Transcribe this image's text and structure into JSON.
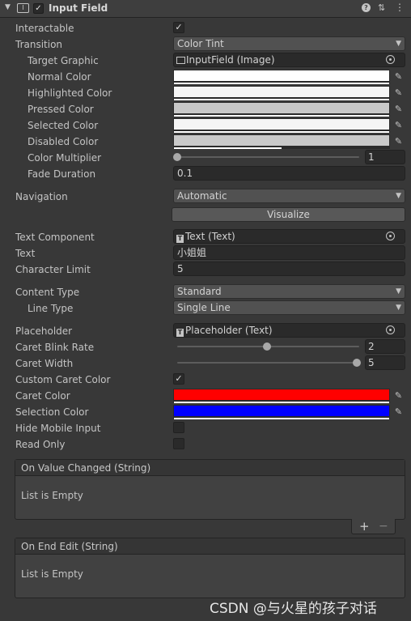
{
  "header": {
    "title": "Input Field",
    "enabled": true
  },
  "icons": {
    "help": "help-icon",
    "settings": "settings-icon",
    "more": "more-vertical-icon"
  },
  "fields": {
    "interactable": {
      "label": "Interactable",
      "checked": true
    },
    "transition": {
      "label": "Transition",
      "value": "Color Tint"
    },
    "target_graphic": {
      "label": "Target Graphic",
      "value": "InputField (Image)"
    },
    "normal_color": {
      "label": "Normal Color",
      "color": "#ffffff"
    },
    "highlighted_color": {
      "label": "Highlighted Color",
      "color": "#f5f5f5"
    },
    "pressed_color": {
      "label": "Pressed Color",
      "color": "#c8c8c8"
    },
    "selected_color": {
      "label": "Selected Color",
      "color": "#f5f5f5"
    },
    "disabled_color": {
      "label": "Disabled Color",
      "color": "#c8c8c8"
    },
    "color_multiplier": {
      "label": "Color Multiplier",
      "value": "1",
      "fraction": 0.0
    },
    "fade_duration": {
      "label": "Fade Duration",
      "value": "0.1"
    },
    "navigation": {
      "label": "Navigation",
      "value": "Automatic"
    },
    "visualize": {
      "label": "Visualize"
    },
    "text_component": {
      "label": "Text Component",
      "value": "Text (Text)"
    },
    "text": {
      "label": "Text",
      "value": "小姐姐"
    },
    "character_limit": {
      "label": "Character Limit",
      "value": "5"
    },
    "content_type": {
      "label": "Content Type",
      "value": "Standard"
    },
    "line_type": {
      "label": "Line Type",
      "value": "Single Line"
    },
    "placeholder": {
      "label": "Placeholder",
      "value": "Placeholder (Text)"
    },
    "caret_blink_rate": {
      "label": "Caret Blink Rate",
      "value": "2",
      "fraction": 0.5
    },
    "caret_width": {
      "label": "Caret Width",
      "value": "5",
      "fraction": 1.0
    },
    "custom_caret_color": {
      "label": "Custom Caret Color",
      "checked": true
    },
    "caret_color": {
      "label": "Caret Color",
      "color": "#ff0000"
    },
    "selection_color": {
      "label": "Selection Color",
      "color": "#0000ff"
    },
    "hide_mobile_input": {
      "label": "Hide Mobile Input",
      "checked": false
    },
    "read_only": {
      "label": "Read Only",
      "checked": false
    }
  },
  "events": {
    "on_value_changed": {
      "title": "On Value Changed (String)",
      "body": "List is Empty"
    },
    "on_end_edit": {
      "title": "On End Edit (String)",
      "body": "List is Empty"
    },
    "add_label": "+",
    "remove_label": "−"
  },
  "watermark": "CSDN @与火星的孩子对话"
}
